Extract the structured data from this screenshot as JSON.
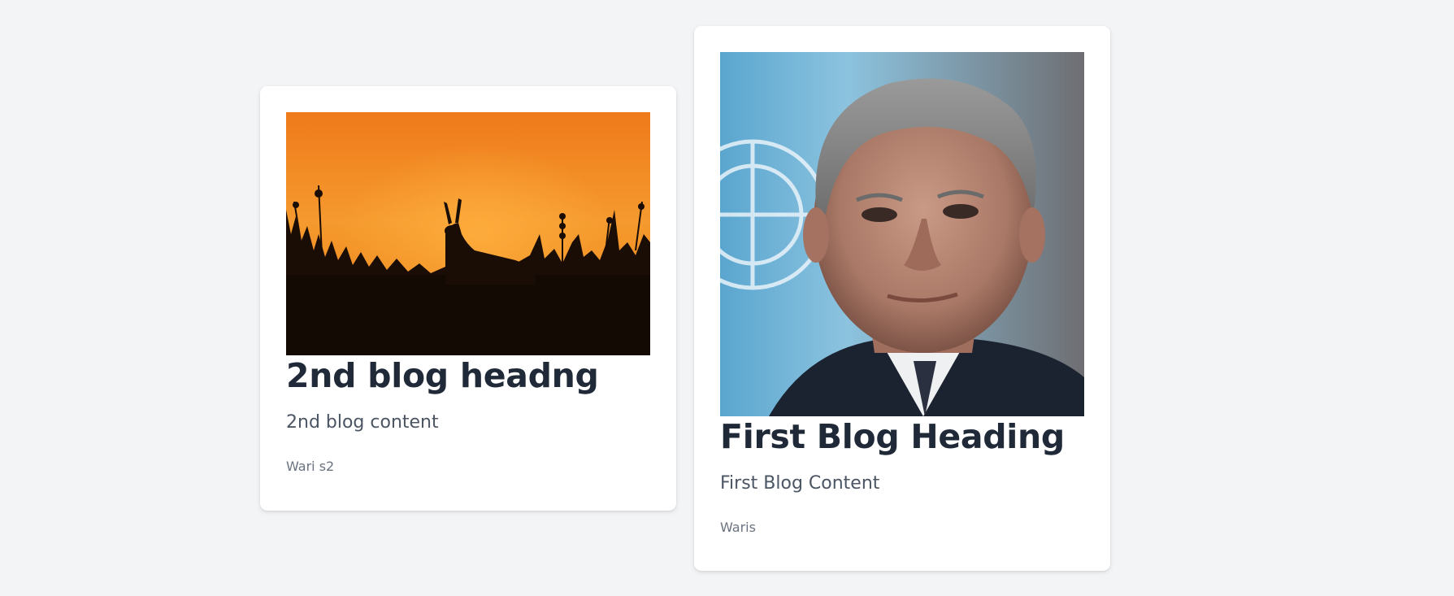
{
  "posts": [
    {
      "heading": "2nd blog headng",
      "content": "2nd blog content",
      "author": "Wari s2",
      "image": "antelope-sunset-silhouette"
    },
    {
      "heading": "First Blog Heading",
      "content": "First Blog Content",
      "author": "Waris",
      "image": "portrait-man-un-flag-background"
    }
  ],
  "colors": {
    "page_background": "#f3f4f6",
    "card_background": "#ffffff",
    "heading": "#1f2937",
    "content": "#4b5563",
    "author": "#6b7280"
  }
}
